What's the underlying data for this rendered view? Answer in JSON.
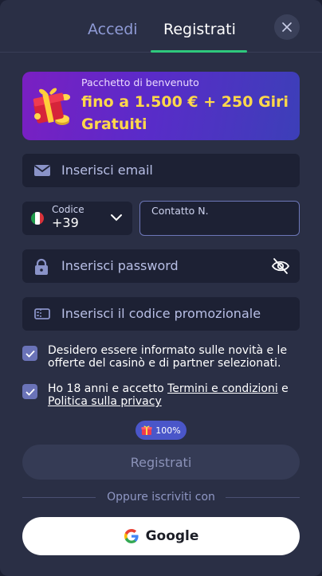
{
  "tabs": {
    "login": "Accedi",
    "register": "Registrati"
  },
  "banner": {
    "label": "Pacchetto di benvenuto",
    "title": "fino a 1.500 € + 250 Giri Gratuiti"
  },
  "form": {
    "email_placeholder": "Inserisci email",
    "phone_code_label": "Codice",
    "phone_code_value": "+39",
    "phone_number_label": "Contatto N.",
    "password_placeholder": "Inserisci password",
    "promo_placeholder": "Inserisci il codice promozionale"
  },
  "consents": {
    "marketing": "Desidero essere informato sulle novità e le offerte del casinò e di partner selezionati.",
    "age_prefix": "Ho 18 anni e accetto ",
    "terms_link": "Termini e condizioni",
    "age_middle": " e ",
    "privacy_link": "Politica sulla privacy",
    "marketing_checked": true,
    "age_checked": true
  },
  "bonus_chip": {
    "value": "100%"
  },
  "submit_label": "Registrati",
  "social": {
    "or_label": "Oppure iscriviti con",
    "google_label": "Google"
  },
  "colors": {
    "background": "#2a2f45",
    "field": "#1d2134",
    "accent_green": "#2fc87d",
    "banner_title": "#ffd84a",
    "checkbox": "#6a73b8"
  }
}
